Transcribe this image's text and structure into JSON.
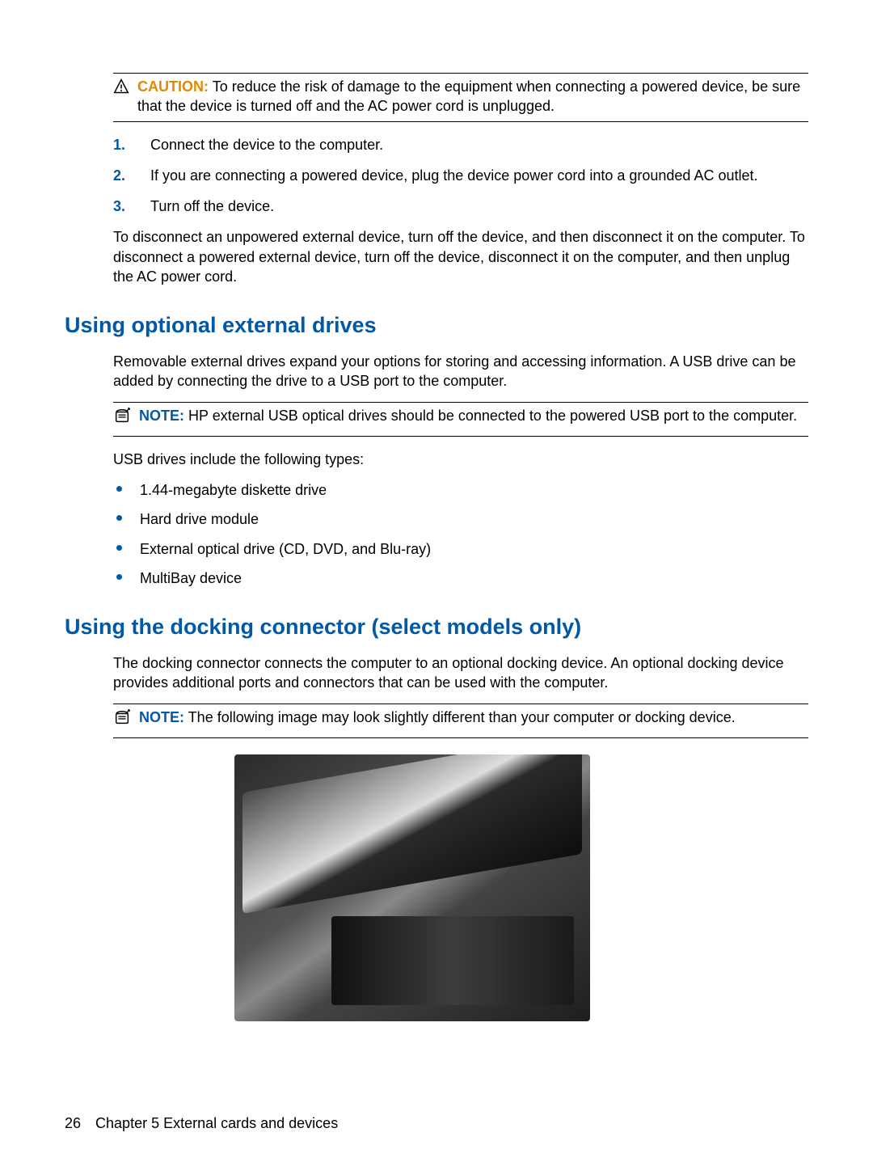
{
  "caution": {
    "prefix": "CAUTION:",
    "text": "To reduce the risk of damage to the equipment when connecting a powered device, be sure that the device is turned off and the AC power cord is unplugged."
  },
  "steps": [
    "Connect the device to the computer.",
    "If you are connecting a powered device, plug the device power cord into a grounded AC outlet.",
    "Turn off the device."
  ],
  "disconnect_para": "To disconnect an unpowered external device, turn off the device, and then disconnect it on the computer. To disconnect a powered external device, turn off the device, disconnect it on the computer, and then unplug the AC power cord.",
  "section_drives": {
    "title": "Using optional external drives",
    "intro": "Removable external drives expand your options for storing and accessing information. A USB drive can be added by connecting the drive to a USB port to the computer.",
    "note_prefix": "NOTE:",
    "note_text": "HP external USB optical drives should be connected to the powered USB port to the computer.",
    "types_intro": "USB drives include the following types:",
    "types": [
      "1.44-megabyte diskette drive",
      "Hard drive module",
      "External optical drive (CD, DVD, and Blu-ray)",
      "MultiBay device"
    ]
  },
  "section_docking": {
    "title": "Using the docking connector (select models only)",
    "intro": "The docking connector connects the computer to an optional docking device. An optional docking device provides additional ports and connectors that can be used with the computer.",
    "note_prefix": "NOTE:",
    "note_text": "The following image may look slightly different than your computer or docking device."
  },
  "footer": {
    "page_number": "26",
    "chapter": "Chapter 5   External cards and devices"
  },
  "step_numbers": [
    "1.",
    "2.",
    "3."
  ]
}
